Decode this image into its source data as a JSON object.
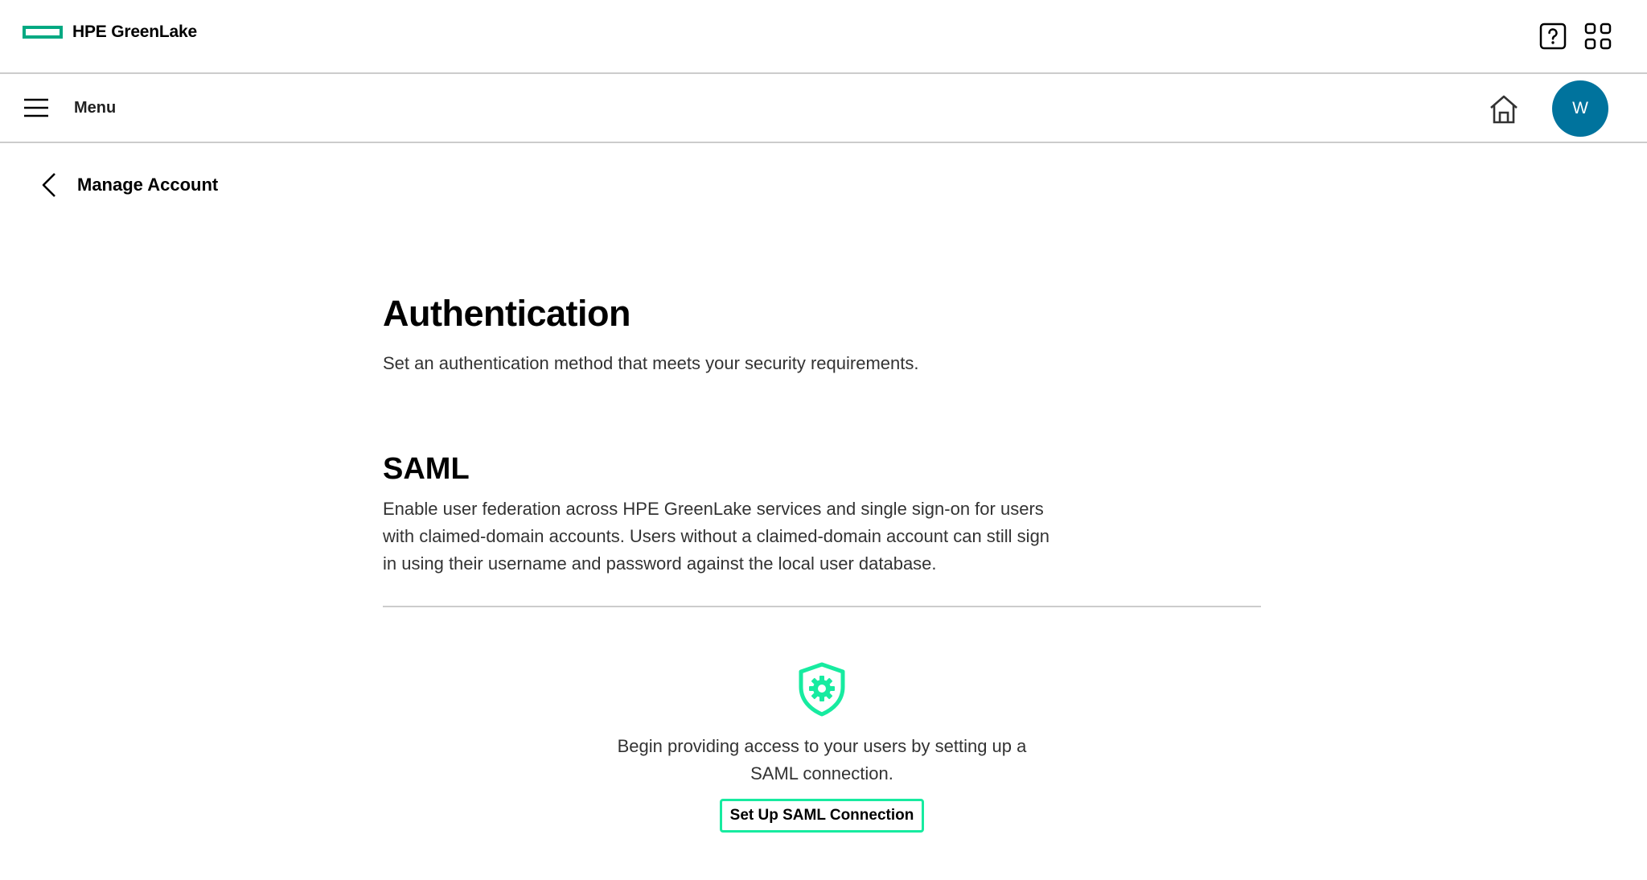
{
  "header": {
    "brand_name": "HPE GreenLake",
    "brand_color": "#01a982",
    "help_icon": "help-icon",
    "apps_icon": "apps-grid-icon"
  },
  "nav": {
    "menu_label": "Menu",
    "home_icon": "home-icon",
    "avatar_initial": "W",
    "avatar_color": "#00739d"
  },
  "back": {
    "label": "Manage Account"
  },
  "page": {
    "title": "Authentication",
    "description": "Set an authentication method that meets your security requirements."
  },
  "saml": {
    "title": "SAML",
    "description": "Enable user federation across HPE GreenLake services and single sign-on for users with claimed-domain accounts. Users without a claimed-domain account can still sign in using their username and password against the local user database.",
    "empty_icon": "shield-gear-icon",
    "empty_text": "Begin providing access to your users by setting up a SAML connection.",
    "button_label": "Set Up SAML Connection",
    "accent_color": "#17eba0"
  }
}
